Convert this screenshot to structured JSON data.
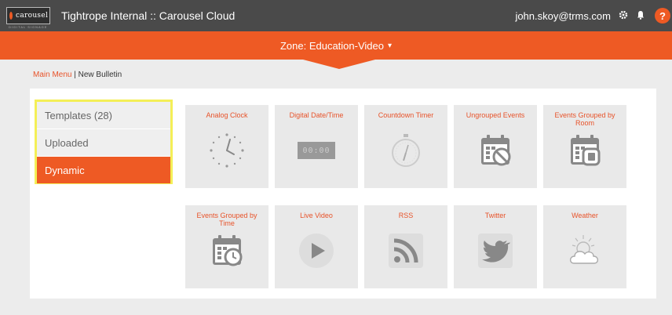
{
  "header": {
    "logo_text": "carousel",
    "logo_sub": "DIGITAL SIGNAGE",
    "app_title": "Tightrope Internal :: Carousel Cloud",
    "user": "john.skoy@trms.com",
    "help": "?"
  },
  "zone": {
    "label": "Zone: Education-Video",
    "caret": "▾"
  },
  "breadcrumb": {
    "main": "Main Menu",
    "separator": " | ",
    "current": "New Bulletin"
  },
  "sidebar": {
    "items": [
      {
        "label": "Templates (28)",
        "active": false
      },
      {
        "label": "Uploaded",
        "active": false
      },
      {
        "label": "Dynamic",
        "active": true
      }
    ]
  },
  "tiles": [
    {
      "label": "Analog Clock",
      "icon": "analog-clock-icon"
    },
    {
      "label": "Digital Date/Time",
      "icon": "digital-clock-icon"
    },
    {
      "label": "Countdown Timer",
      "icon": "stopwatch-icon"
    },
    {
      "label": "Ungrouped Events",
      "icon": "calendar-no-icon"
    },
    {
      "label": "Events Grouped by Room",
      "icon": "calendar-room-icon"
    },
    {
      "label": "Events Grouped by Time",
      "icon": "calendar-clock-icon"
    },
    {
      "label": "Live Video",
      "icon": "play-icon"
    },
    {
      "label": "RSS",
      "icon": "rss-icon"
    },
    {
      "label": "Twitter",
      "icon": "twitter-icon"
    },
    {
      "label": "Weather",
      "icon": "weather-icon"
    }
  ],
  "digital_display": "00:00",
  "colors": {
    "accent": "#ee5a24",
    "topbar": "#4a4a4a",
    "highlight": "#f4ef57",
    "tile": "#e9e9e9"
  }
}
